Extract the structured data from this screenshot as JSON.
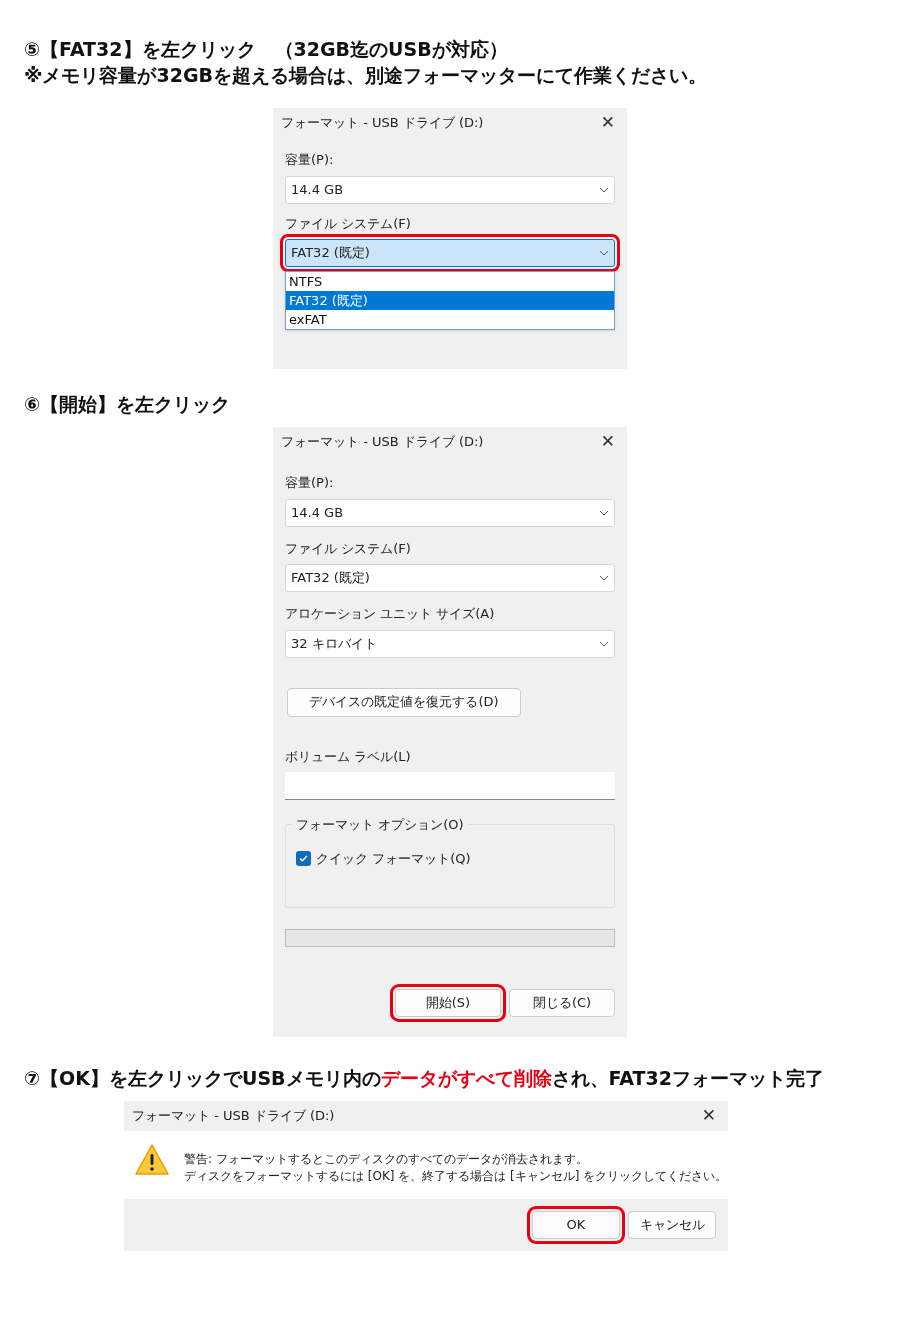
{
  "steps": [
    {
      "heading": [
        {
          "text": "⑤【FAT32】を左クリック　（32GB迄のUSBが対応）",
          "highlight": false
        }
      ],
      "subheading": "※メモリ容量が32GBを超える場合は、別途フォーマッターにて作業ください。",
      "dialog": {
        "kind": "select",
        "title": "フォーマット - USB ドライブ (D:)",
        "close": "✕",
        "fields": [
          {
            "label": "容量(P):",
            "value": "14.4 GB",
            "outlined": false
          },
          {
            "label": "ファイル システム(F)",
            "value": "FAT32 (既定)",
            "outlined": true,
            "expanded": true
          }
        ],
        "options": [
          {
            "label": "NTFS",
            "selected": false
          },
          {
            "label": "FAT32 (既定)",
            "selected": true
          },
          {
            "label": "exFAT",
            "selected": false
          }
        ]
      }
    },
    {
      "heading": [
        {
          "text": "⑥【開始】を左クリック",
          "highlight": false
        }
      ],
      "dialog": {
        "kind": "format",
        "title": "フォーマット - USB ドライブ (D:)",
        "close": "✕",
        "fields": [
          {
            "label": "容量(P):",
            "value": "14.4 GB",
            "outlined": false
          },
          {
            "label": "ファイル システム(F)",
            "value": "FAT32 (既定)",
            "outlined": false
          },
          {
            "label": "アロケーション ユニット サイズ(A)",
            "value": "32 キロバイト",
            "outlined": false
          }
        ],
        "restore_button": "デバイスの既定値を復元する(D)",
        "volume_label": {
          "label": "ボリューム ラベル(L)"
        },
        "options_group": {
          "legend": "フォーマット オプション(O)",
          "quick_format": {
            "label": "クイック フォーマット(Q)",
            "checked": true
          }
        },
        "buttons": [
          {
            "label": "開始(S)",
            "outlined": true
          },
          {
            "label": "閉じる(C)",
            "outlined": false
          }
        ]
      }
    },
    {
      "heading": [
        {
          "text": "⑦【OK】を左クリックでUSBメモリ内の",
          "highlight": false
        },
        {
          "text": "データがすべて削除",
          "highlight": true
        },
        {
          "text": "され、FAT32フォーマット完了",
          "highlight": false
        }
      ],
      "dialog": {
        "kind": "warning",
        "title": "フォーマット - USB ドライブ (D:)",
        "close": "✕",
        "message": [
          "警告: フォーマットするとこのディスクのすべてのデータが消去されます。",
          "ディスクをフォーマットするには [OK] を、終了する場合は [キャンセル] をクリックしてください。"
        ],
        "buttons": [
          {
            "label": "OK",
            "outlined": true
          },
          {
            "label": "キャンセル",
            "outlined": false
          }
        ]
      }
    }
  ]
}
